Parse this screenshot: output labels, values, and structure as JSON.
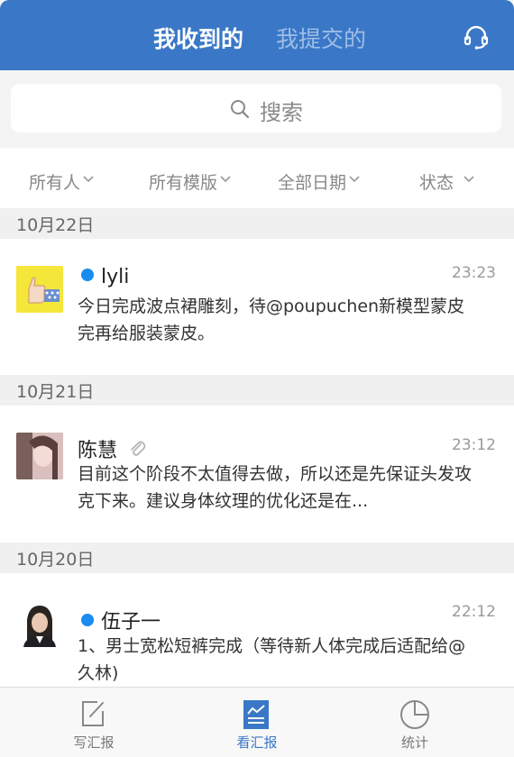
{
  "header": {
    "tab_received": "我收到的",
    "tab_submitted": "我提交的",
    "support_icon": "headset-icon"
  },
  "search": {
    "placeholder": "搜索",
    "icon": "search-icon"
  },
  "filters": [
    {
      "label": "所有人"
    },
    {
      "label": "所有模版"
    },
    {
      "label": "全部日期"
    },
    {
      "label": "状态"
    }
  ],
  "groups": [
    {
      "date": "10月22日",
      "report": {
        "author": "lyli",
        "unread": true,
        "time": "23:23",
        "text": "今日完成波点裙雕刻，待@poupuchen新模型蒙皮完再给服装蒙皮。"
      }
    },
    {
      "date": "10月21日",
      "report": {
        "author": "陈慧",
        "unread": false,
        "has_attachment": true,
        "time": "23:12",
        "text": "目前这个阶段不太值得去做，所以还是先保证头发攻克下来。建议身体纹理的优化还是在..."
      }
    },
    {
      "date": "10月20日",
      "report": {
        "author": "伍子一",
        "unread": true,
        "time": "22:12",
        "text": "1、男士宽松短裤完成（等待新人体完成后适配给@久林)"
      }
    }
  ],
  "bottom_nav": {
    "write": "写汇报",
    "view": "看汇报",
    "stats": "统计",
    "active": "看汇报"
  },
  "colors": {
    "brand": "#3a78c7",
    "unread_dot": "#1a8cf0"
  }
}
